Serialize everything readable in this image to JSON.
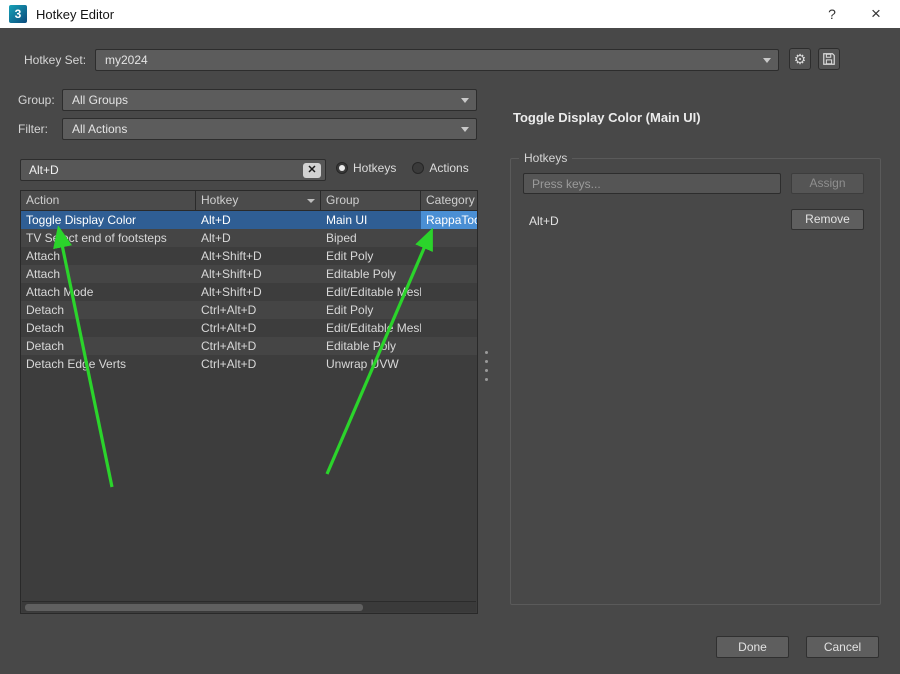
{
  "window": {
    "title": "Hotkey Editor",
    "app_icon_letter": "3",
    "help_glyph": "?",
    "close_glyph": "×"
  },
  "toolbar": {
    "hotkey_set_label": "Hotkey Set:",
    "hotkey_set_value": "my2024",
    "gear_glyph": "⚙"
  },
  "filters": {
    "group_label": "Group:",
    "group_value": "All Groups",
    "filter_label": "Filter:",
    "filter_value": "All Actions"
  },
  "search": {
    "value": "Alt+D",
    "clear_glyph": "✕",
    "radios": [
      {
        "label": "Hotkeys",
        "selected": true
      },
      {
        "label": "Actions",
        "selected": false
      }
    ]
  },
  "table": {
    "columns": [
      "Action",
      "Hotkey",
      "Group",
      "Category"
    ],
    "rows": [
      {
        "action": "Toggle Display Color",
        "hotkey": "Alt+D",
        "group": "Main UI",
        "category": "RappaTools",
        "selected": true
      },
      {
        "action": "TV Select end of footsteps",
        "hotkey": "Alt+D",
        "group": "Biped",
        "category": "",
        "selected": false
      },
      {
        "action": "Attach",
        "hotkey": "Alt+Shift+D",
        "group": "Edit Poly",
        "category": "",
        "selected": false
      },
      {
        "action": "Attach",
        "hotkey": "Alt+Shift+D",
        "group": "Editable Poly",
        "category": "",
        "selected": false
      },
      {
        "action": "Attach Mode",
        "hotkey": "Alt+Shift+D",
        "group": "Edit/Editable Mesh",
        "category": "",
        "selected": false
      },
      {
        "action": "Detach",
        "hotkey": "Ctrl+Alt+D",
        "group": "Edit Poly",
        "category": "",
        "selected": false
      },
      {
        "action": "Detach",
        "hotkey": "Ctrl+Alt+D",
        "group": "Edit/Editable Mesh",
        "category": "",
        "selected": false
      },
      {
        "action": "Detach",
        "hotkey": "Ctrl+Alt+D",
        "group": "Editable Poly",
        "category": "",
        "selected": false
      },
      {
        "action": "Detach Edge Verts",
        "hotkey": "Ctrl+Alt+D",
        "group": "Unwrap UVW",
        "category": "",
        "selected": false
      }
    ]
  },
  "detail": {
    "title": "Toggle Display Color (Main UI)",
    "group_title": "Hotkeys",
    "press_keys_placeholder": "Press keys...",
    "assign_label": "Assign",
    "assigned_hotkey": "Alt+D",
    "remove_label": "Remove"
  },
  "footer": {
    "done_label": "Done",
    "cancel_label": "Cancel"
  },
  "colors": {
    "selection_blue": "#2f5e94",
    "category_highlight": "#4a8fd4",
    "arrow_green": "#2bd42b"
  }
}
